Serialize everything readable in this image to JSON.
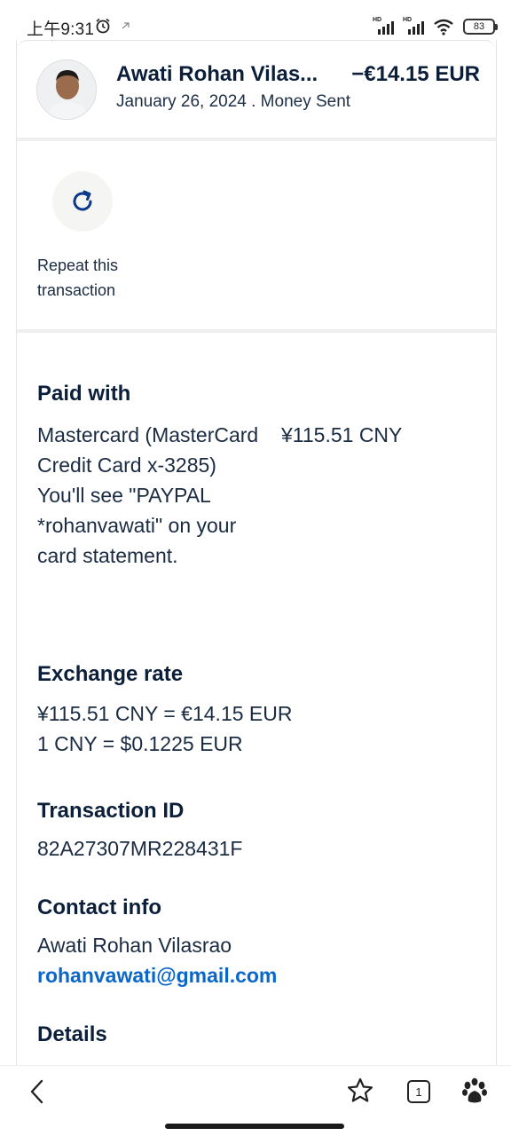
{
  "status_bar": {
    "time": "上午9:31",
    "battery": "83",
    "signal_label": "HD"
  },
  "header": {
    "name": "Awati Rohan Vilas...",
    "amount": "−€14.15 EUR",
    "date_type": "January 26, 2024 . Money Sent"
  },
  "repeat": {
    "label": "Repeat this transaction"
  },
  "paid_with": {
    "title": "Paid with",
    "description": "Mastercard (MasterCard Credit Card x-3285) You'll see \"PAYPAL *rohanvawati\" on your card statement.",
    "amount": "¥115.51 CNY"
  },
  "exchange_rate": {
    "title": "Exchange rate",
    "line1": "¥115.51 CNY = €14.15 EUR",
    "line2": "1 CNY = $0.1225 EUR"
  },
  "transaction": {
    "title": "Transaction ID",
    "id": "82A27307MR228431F"
  },
  "contact": {
    "title": "Contact info",
    "name": "Awati Rohan Vilasrao",
    "email": "rohanvawati@gmail.com"
  },
  "details": {
    "title": "Details"
  },
  "bottom_nav": {
    "tabs_count": "1"
  },
  "colors": {
    "primary_text": "#0b1f3a",
    "link": "#0a67c9",
    "repeat_icon": "#0b3a8a"
  }
}
